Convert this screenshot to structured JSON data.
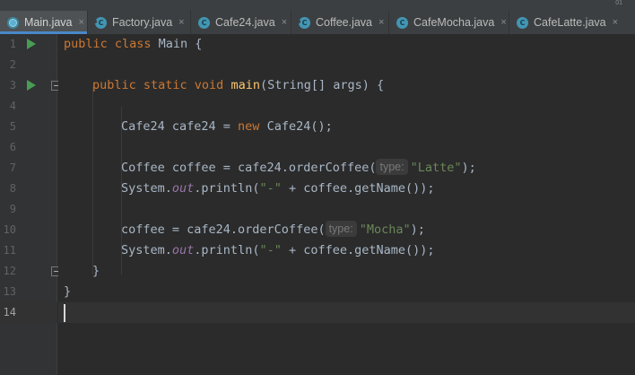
{
  "window": {
    "corner_text": "01"
  },
  "tabs": [
    {
      "label": "Main.java",
      "icon": "java-file-icon",
      "active": true
    },
    {
      "label": "Factory.java",
      "icon": "interface-icon",
      "active": false
    },
    {
      "label": "Cafe24.java",
      "icon": "class-icon",
      "active": false
    },
    {
      "label": "Coffee.java",
      "icon": "interface-icon",
      "active": false
    },
    {
      "label": "CafeMocha.java",
      "icon": "class-icon",
      "active": false
    },
    {
      "label": "CafeLatte.java",
      "icon": "class-icon",
      "active": false
    }
  ],
  "tab_close_glyph": "×",
  "tab_icon_letter": "C",
  "gutter": {
    "line_numbers": [
      "1",
      "2",
      "3",
      "4",
      "5",
      "6",
      "7",
      "8",
      "9",
      "10",
      "11",
      "12",
      "13",
      "14"
    ],
    "run_lines": [
      1,
      3
    ],
    "current_line": 14
  },
  "code": {
    "l1": {
      "kw": "public class ",
      "name": "Main {"
    },
    "l3": {
      "kw": "public static void ",
      "fn": "main",
      "rest": "(String[] args) {"
    },
    "l5": {
      "a": "Cafe24 cafe24 = ",
      "kw": "new ",
      "b": "Cafe24();"
    },
    "l7": {
      "a": "Coffee coffee = cafe24.orderCoffee(",
      "hint": "type:",
      "str": "\"Latte\"",
      "b": ");"
    },
    "l8": {
      "a": "System.",
      "fld": "out",
      "b": ".println(",
      "str": "\"-\"",
      "c": " + coffee.getName());"
    },
    "l10": {
      "a": "coffee = cafe24.orderCoffee(",
      "hint": "type:",
      "str": "\"Mocha\"",
      "b": ");"
    },
    "l11": {
      "a": "System.",
      "fld": "out",
      "b": ".println(",
      "str": "\"-\"",
      "c": " + coffee.getName());"
    },
    "l12": {
      "a": "}"
    },
    "l13": {
      "a": "}"
    }
  }
}
